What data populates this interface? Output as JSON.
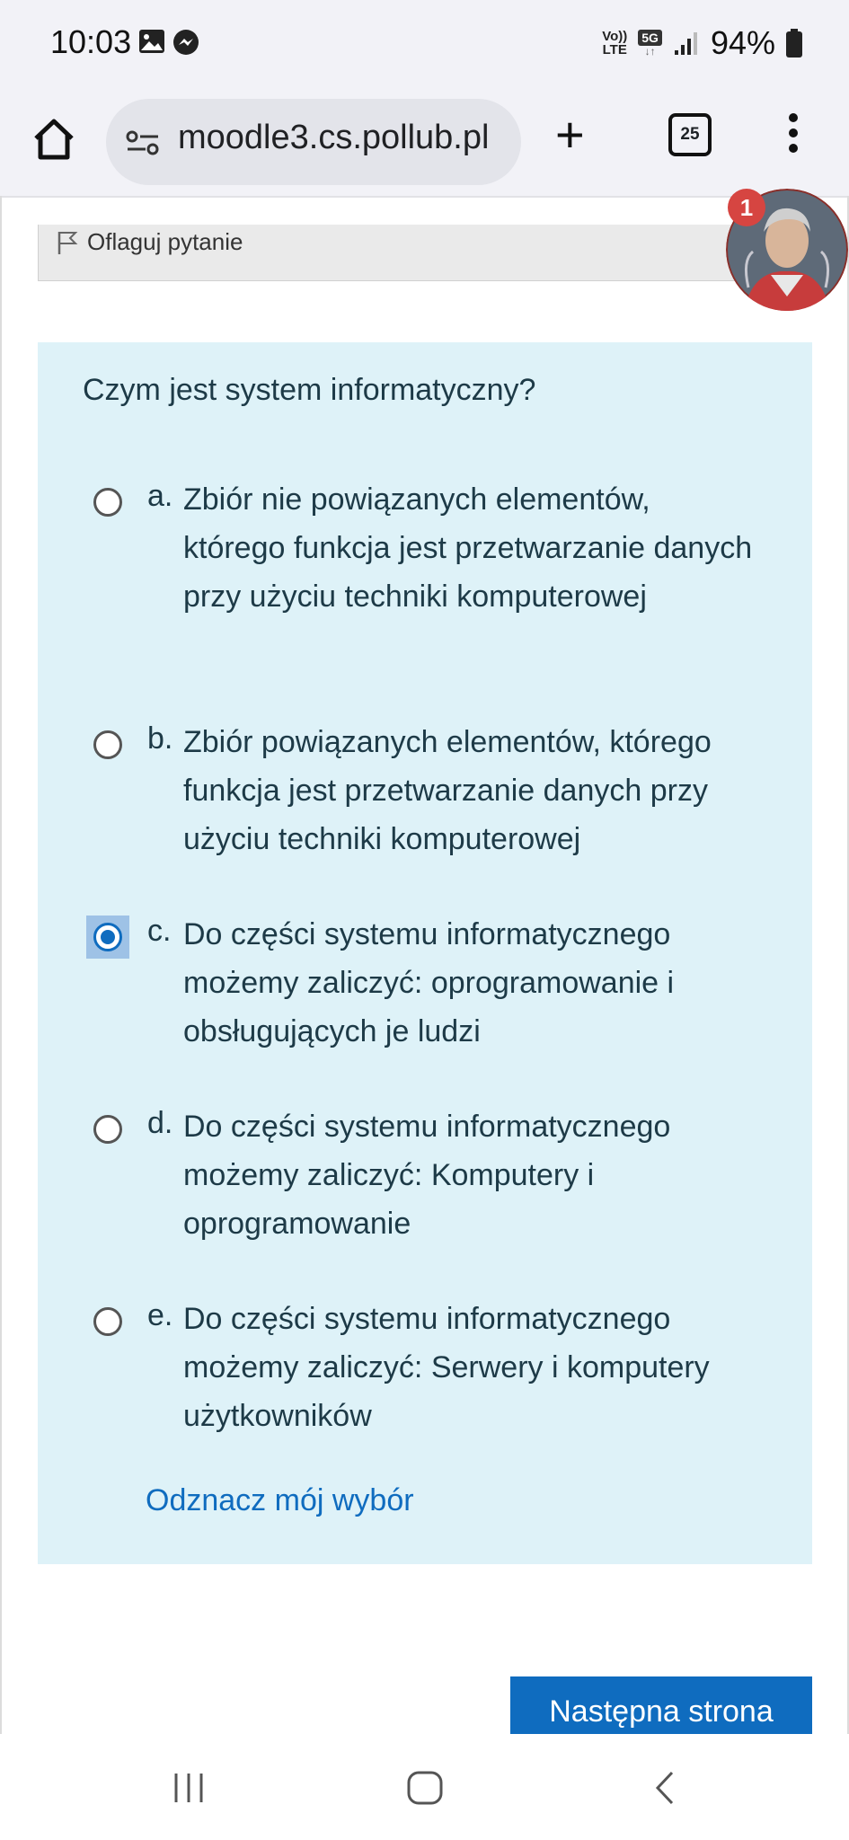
{
  "status_bar": {
    "time": "10:03",
    "network_top": "Vo))",
    "network_bottom": "LTE",
    "network_type": "5G",
    "battery": "94%"
  },
  "browser": {
    "url": "moodle3.cs.pollub.pl",
    "tab_count": "25"
  },
  "page": {
    "flag_label": "Oflaguj pytanie",
    "notification_count": "1",
    "question": "Czym jest system informatyczny?",
    "answers": [
      {
        "letter": "a.",
        "text": "Zbiór nie powiązanych elementów, którego funkcja jest przetwarzanie danych przy użyciu techniki komputerowej",
        "selected": false
      },
      {
        "letter": "b.",
        "text": "Zbiór powiązanych elementów, którego funkcja jest przetwarzanie danych przy użyciu techniki komputerowej",
        "selected": false
      },
      {
        "letter": "c.",
        "text": "Do części systemu informatycznego możemy zaliczyć: oprogramowanie i obsługujących je ludzi",
        "selected": true
      },
      {
        "letter": "d.",
        "text": "Do części systemu informatycznego możemy zaliczyć: Komputery i oprogramowanie",
        "selected": false
      },
      {
        "letter": "e.",
        "text": "Do części systemu informatycznego możemy zaliczyć: Serwery i komputery użytkowników",
        "selected": false
      }
    ],
    "clear_choice": "Odznacz mój wybór",
    "next_button": "Następna strona"
  },
  "colors": {
    "accent": "#0f6cbf",
    "question_bg": "#def2f8",
    "badge": "#d64541"
  }
}
